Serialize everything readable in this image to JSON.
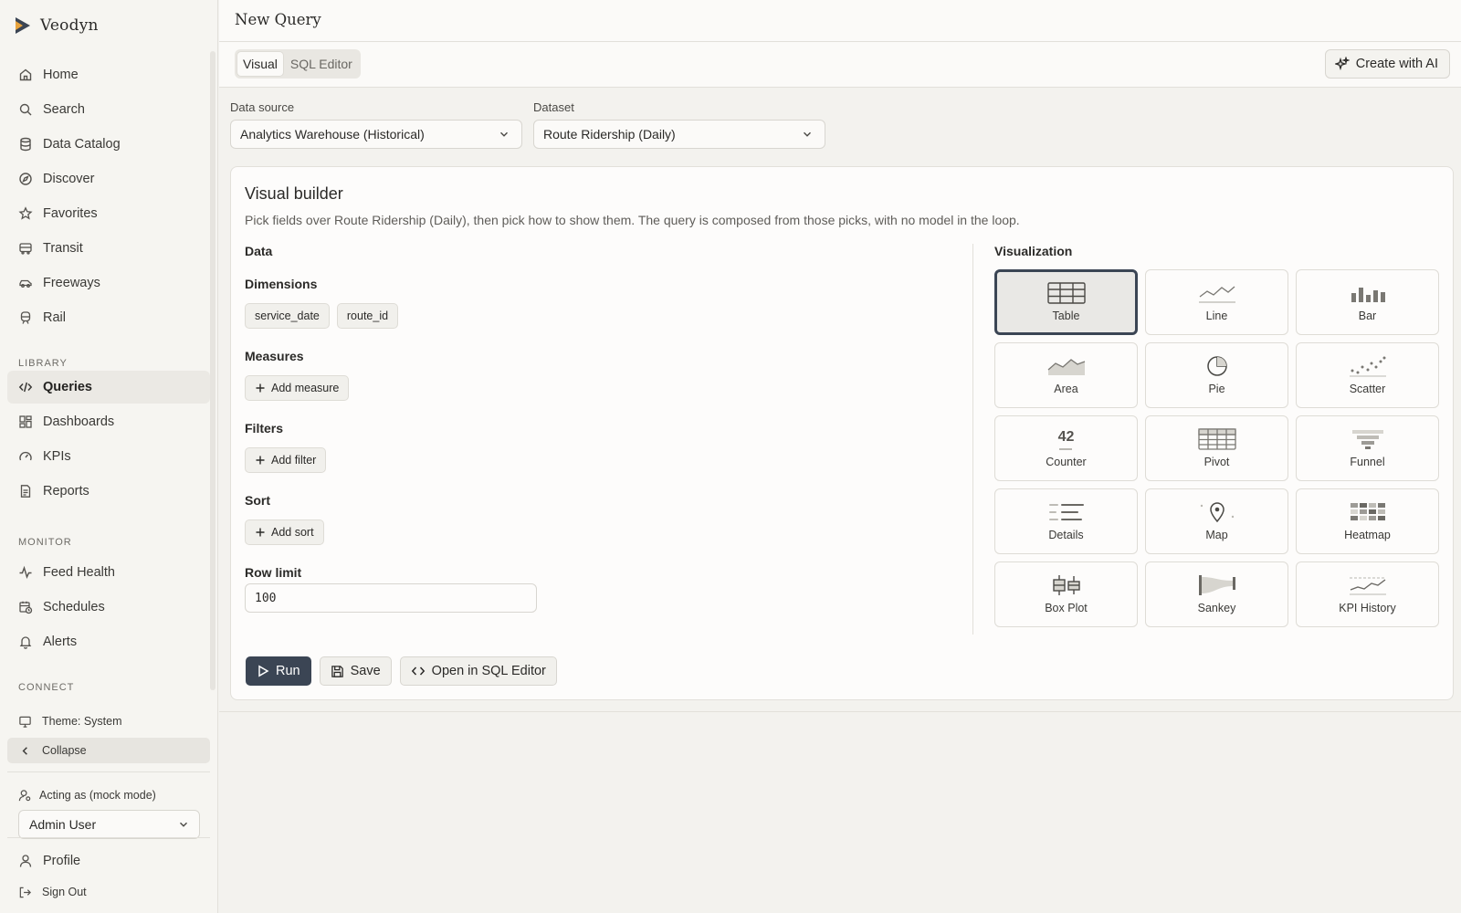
{
  "app": {
    "name": "Veodyn"
  },
  "sidebar": {
    "primary": [
      {
        "label": "Home",
        "icon": "home-icon"
      },
      {
        "label": "Search",
        "icon": "search-icon"
      },
      {
        "label": "Data Catalog",
        "icon": "database-icon"
      },
      {
        "label": "Discover",
        "icon": "compass-icon"
      },
      {
        "label": "Favorites",
        "icon": "star-icon"
      },
      {
        "label": "Transit",
        "icon": "bus-icon"
      },
      {
        "label": "Freeways",
        "icon": "car-icon"
      },
      {
        "label": "Rail",
        "icon": "train-icon"
      }
    ],
    "library_label": "LIBRARY",
    "library": [
      {
        "label": "Queries",
        "icon": "code-icon",
        "active": true
      },
      {
        "label": "Dashboards",
        "icon": "dashboard-icon"
      },
      {
        "label": "KPIs",
        "icon": "gauge-icon"
      },
      {
        "label": "Reports",
        "icon": "report-icon"
      }
    ],
    "monitor_label": "MONITOR",
    "monitor": [
      {
        "label": "Feed Health",
        "icon": "activity-icon"
      },
      {
        "label": "Schedules",
        "icon": "calendar-clock-icon"
      },
      {
        "label": "Alerts",
        "icon": "bell-icon"
      }
    ],
    "connect_label": "CONNECT",
    "theme_label": "Theme: System",
    "collapse_label": "Collapse",
    "acting_label": "Acting as (mock mode)",
    "acting_user": "Admin User",
    "profile_label": "Profile",
    "signout_label": "Sign Out"
  },
  "header": {
    "title": "New Query"
  },
  "tabs": {
    "visual": "Visual",
    "sql": "SQL Editor",
    "active": "visual"
  },
  "ai_button": "Create with AI",
  "source": {
    "data_source_label": "Data source",
    "data_source_value": "Analytics Warehouse (Historical)",
    "dataset_label": "Dataset",
    "dataset_value": "Route Ridership (Daily)"
  },
  "builder": {
    "title": "Visual builder",
    "description": "Pick fields over Route Ridership (Daily), then pick how to show them. The query is composed from those picks, with no model in the loop.",
    "data_heading": "Data",
    "dimensions_heading": "Dimensions",
    "dimensions": [
      "service_date",
      "route_id"
    ],
    "measures_heading": "Measures",
    "add_measure": "Add measure",
    "filters_heading": "Filters",
    "add_filter": "Add filter",
    "sort_heading": "Sort",
    "add_sort": "Add sort",
    "row_limit_heading": "Row limit",
    "row_limit_value": "100"
  },
  "visualization": {
    "heading": "Visualization",
    "selected": "Table",
    "options": [
      {
        "label": "Table",
        "icon": "table-icon"
      },
      {
        "label": "Line",
        "icon": "line-chart-icon"
      },
      {
        "label": "Bar",
        "icon": "bar-chart-icon"
      },
      {
        "label": "Area",
        "icon": "area-chart-icon"
      },
      {
        "label": "Pie",
        "icon": "pie-chart-icon"
      },
      {
        "label": "Scatter",
        "icon": "scatter-chart-icon"
      },
      {
        "label": "Counter",
        "icon": "counter-icon",
        "icon_text": "42"
      },
      {
        "label": "Pivot",
        "icon": "pivot-icon"
      },
      {
        "label": "Funnel",
        "icon": "funnel-icon"
      },
      {
        "label": "Details",
        "icon": "details-icon"
      },
      {
        "label": "Map",
        "icon": "map-pin-icon"
      },
      {
        "label": "Heatmap",
        "icon": "heatmap-icon"
      },
      {
        "label": "Box Plot",
        "icon": "box-plot-icon"
      },
      {
        "label": "Sankey",
        "icon": "sankey-icon"
      },
      {
        "label": "KPI History",
        "icon": "kpi-history-icon"
      }
    ]
  },
  "actions": {
    "run": "Run",
    "save": "Save",
    "open_sql": "Open in SQL Editor"
  },
  "colors": {
    "primary": "#3b4554",
    "accent": "#e8a33d",
    "background": "#f3f2ee"
  }
}
